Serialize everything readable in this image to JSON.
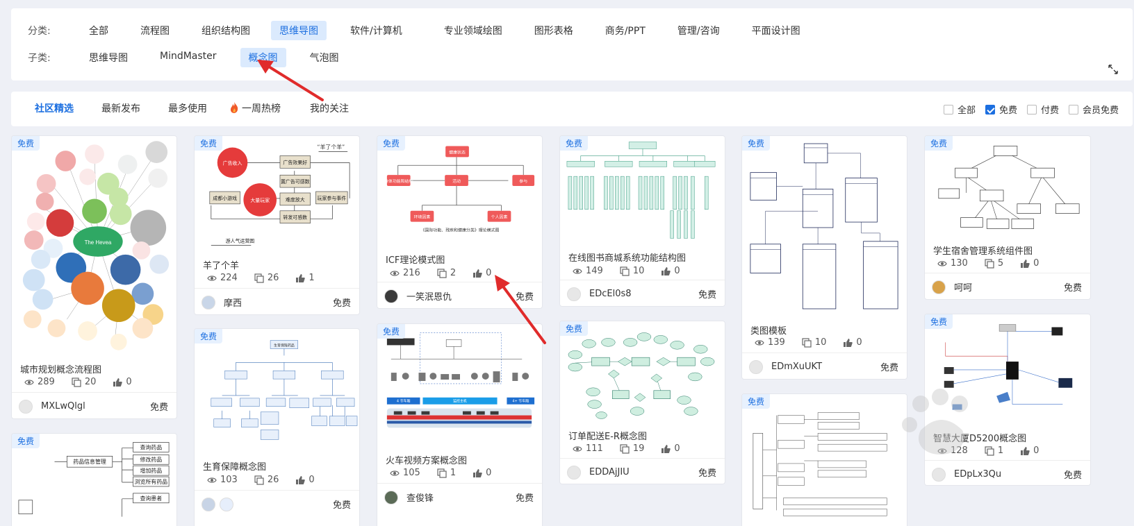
{
  "filters": {
    "category_label": "分类:",
    "categories": [
      "全部",
      "流程图",
      "组织结构图",
      "思维导图",
      "软件/计算机",
      "专业领域绘图",
      "图形表格",
      "商务/PPT",
      "管理/咨询",
      "平面设计图"
    ],
    "subcategory_label": "子类:",
    "subcategories": [
      "思维导图",
      "MindMaster",
      "概念图",
      "气泡图"
    ]
  },
  "tabs": [
    "社区精选",
    "最新发布",
    "最多使用",
    "一周热榜",
    "我的关注"
  ],
  "price_filters": [
    {
      "label": "全部",
      "checked": false
    },
    {
      "label": "免费",
      "checked": true
    },
    {
      "label": "付费",
      "checked": false
    },
    {
      "label": "会员免费",
      "checked": false
    }
  ],
  "colors": {
    "accent": "#1c6fe0",
    "arrow": "#e02b2b"
  },
  "cards": [
    {
      "badge": "免费",
      "title": "城市规划概念流程图",
      "views": "289",
      "copies": "20",
      "likes": "0",
      "author": "MXLwQlgl",
      "price": "免费"
    },
    {
      "badge": "免费",
      "title": "羊了个羊",
      "views": "224",
      "copies": "26",
      "likes": "1",
      "author": "摩西",
      "price": "免费"
    },
    {
      "badge": "免费",
      "title": "ICF理论模式图",
      "views": "216",
      "copies": "2",
      "likes": "0",
      "author": "一笑泯恩仇",
      "price": "免费"
    },
    {
      "badge": "免费",
      "title": "在线图书商城系统功能结构图",
      "views": "149",
      "copies": "10",
      "likes": "0",
      "author": "EDcEl0s8",
      "price": "免费"
    },
    {
      "badge": "免费",
      "title": "类图模板",
      "views": "139",
      "copies": "10",
      "likes": "0",
      "author": "EDmXuUKT",
      "price": "免费"
    },
    {
      "badge": "免费",
      "title": "学生宿舍管理系统组件图",
      "views": "130",
      "copies": "5",
      "likes": "0",
      "author": "呵呵",
      "price": "免费"
    },
    {
      "badge": "免费",
      "title": "生育保障概念图",
      "views": "103",
      "copies": "26",
      "likes": "0",
      "author": "",
      "price": "免费"
    },
    {
      "badge": "免费",
      "title": "火车视频方案概念图",
      "views": "105",
      "copies": "1",
      "likes": "0",
      "author": "查俊锋",
      "price": "免费"
    },
    {
      "badge": "免费",
      "title": "订单配送E-R概念图",
      "views": "111",
      "copies": "19",
      "likes": "0",
      "author": "EDDAjJIU",
      "price": "免费"
    },
    {
      "badge": "免费",
      "title": "",
      "views": "",
      "copies": "",
      "likes": "",
      "author": "",
      "price": ""
    },
    {
      "badge": "免费",
      "title": "智慧大厦D5200概念图",
      "views": "128",
      "copies": "1",
      "likes": "0",
      "author": "EDpLx3Qu",
      "price": "免费"
    },
    {
      "badge": "免费",
      "title": "",
      "views": "",
      "copies": "",
      "likes": "",
      "author": "",
      "price": ""
    }
  ],
  "thumb_texts": {
    "c1_center": "The Hevea",
    "c2_header": "“羊了个羊”",
    "c2_boxes": [
      "广告收入",
      "大量玩家",
      "广告效果好",
      "置广告可感数",
      "难度放大",
      "转发可感数",
      "成都小游戏",
      "玩家参与事件"
    ],
    "c2_caption": "游人气运营图",
    "c3_nodes": [
      "健康状态",
      "身体功能和结构",
      "活动",
      "参与",
      "环境因素",
      "个人因素"
    ],
    "c3_caption": "《国际功能、残疾和健康分类》理论模式图",
    "c7_root": "生育保障药品",
    "c8_bars": [
      "4 节车厢",
      "监控主机",
      "4+ 节车厢"
    ],
    "c12_root": "药品信息管理",
    "c12_items": [
      "查询药品",
      "修改药品",
      "增加药品",
      "浏览所有药品",
      "查询患者"
    ]
  }
}
